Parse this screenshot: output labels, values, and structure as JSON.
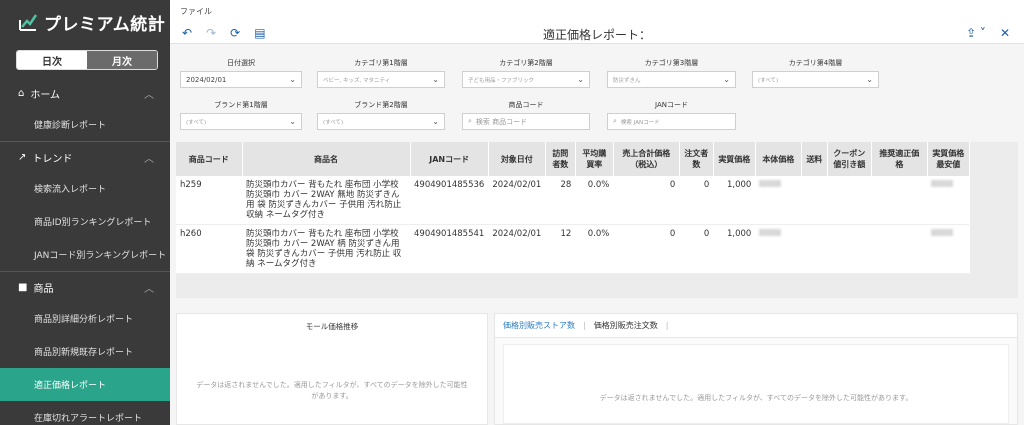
{
  "app": {
    "logo": "プレミアム統計"
  },
  "sidebar": {
    "period": {
      "daily": "日次",
      "monthly": "月次"
    },
    "sections": [
      {
        "label": "ホーム",
        "items": [
          "健康診断レポート"
        ]
      },
      {
        "label": "トレンド",
        "items": [
          "検索流入レポート",
          "商品ID別ランキングレポート",
          "JANコード別ランキングレポート"
        ]
      },
      {
        "label": "商品",
        "items": [
          "商品別詳細分析レポート",
          "商品別新規既存レポート",
          "適正価格レポート",
          "在庫切れアラートレポート"
        ]
      }
    ],
    "active_item": "適正価格レポート"
  },
  "topbar": {
    "file_menu": "ファイル",
    "title": "適正価格レポート："
  },
  "filters": {
    "date": {
      "label": "日付選択",
      "value": "2024/02/01"
    },
    "cat1": {
      "label": "カテゴリ第1階層",
      "value": "ベビー, キッズ, マタニティ"
    },
    "cat2": {
      "label": "カテゴリ第2階層",
      "value": "子ども用品・ファブリック"
    },
    "cat3": {
      "label": "カテゴリ第3階層",
      "value": "防災ずきん"
    },
    "cat4": {
      "label": "カテゴリ第4階層",
      "value": "(すべて)"
    },
    "brand1": {
      "label": "ブランド第1階層",
      "value": "(すべて)"
    },
    "brand2": {
      "label": "ブランド第2階層",
      "value": "(すべて)"
    },
    "product_code": {
      "label": "商品コード",
      "placeholder": "検索 商品コード"
    },
    "jan_code": {
      "label": "JANコード",
      "placeholder": "検索 JANコード"
    }
  },
  "table": {
    "headers": [
      "商品コード",
      "商品名",
      "JANコード",
      "対象日付",
      "訪問者数",
      "平均購買率",
      "売上合計価格（税込）",
      "注文者数",
      "実質価格",
      "本体価格",
      "送料",
      "クーポン値引き額",
      "推奨適正価格",
      "実質価格最安値"
    ],
    "rows": [
      {
        "code": "h259",
        "name": "防災頭巾カバー 背もたれ 座布団 小学校 防災頭巾 カバー 2WAY 無地 防災ずきん用 袋 防災ずきんカバー 子供用 汚れ防止 収納 ネームタグ付き",
        "jan": "4904901485536",
        "date": "2024/02/01",
        "visitors": "28",
        "rate": "0.0%",
        "sales": "0",
        "orders": "0",
        "real_price": "1,000"
      },
      {
        "code": "h260",
        "name": "防災頭巾カバー 背もたれ 座布団 小学校 防災頭巾 カバー 2WAY 柄 防災ずきん用袋 防災ずきんカバー 子供用 汚れ防止 収納 ネームタグ付き",
        "jan": "4904901485541",
        "date": "2024/02/01",
        "visitors": "12",
        "rate": "0.0%",
        "sales": "0",
        "orders": "0",
        "real_price": "1,000"
      }
    ]
  },
  "panels": {
    "left_title": "モール価格推移",
    "left_msg": "データは返されませんでした。適用したフィルタが、すべてのデータを除外した可能性があります。",
    "tab1": "価格別販売ストア数",
    "tab2": "価格別販売注文数",
    "right_msg": "データは返されませんでした。適用したフィルタが、すべてのデータを除外した可能性があります。"
  },
  "colors": {
    "sidebar_bg": "#3a3a3a",
    "active": "#2aa58c",
    "link": "#1a5ea8"
  }
}
